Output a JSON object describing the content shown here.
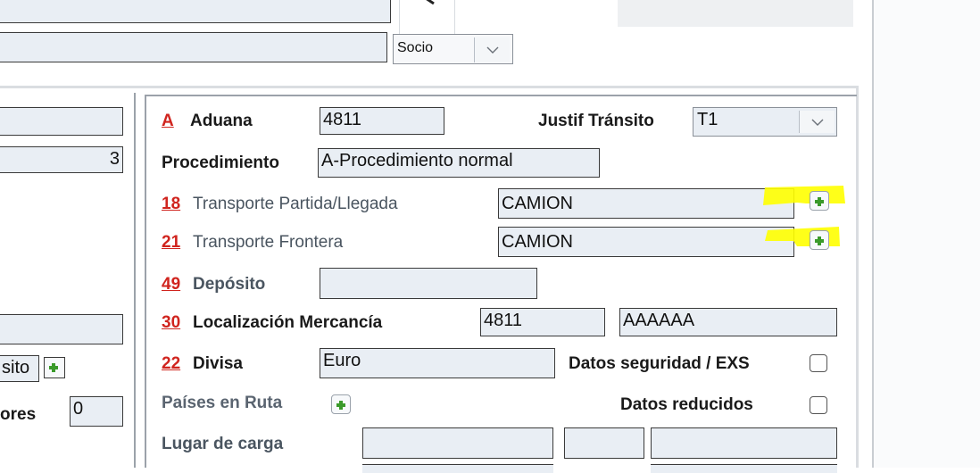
{
  "top": {
    "field1_value": "",
    "field2_value": "",
    "socio_select": "Socio"
  },
  "left_panel": {
    "field_a_value": "",
    "field_b_value": "3",
    "field_c_value": "",
    "transito_text": "sito",
    "errores_label": "ores",
    "errores_value": "0"
  },
  "form": {
    "aduana": {
      "code": "A",
      "label": "Aduana",
      "value": "4811"
    },
    "justif": {
      "label": "Justif Tránsito",
      "value": "T1"
    },
    "procedimiento": {
      "label": "Procedimiento",
      "value": "A-Procedimiento normal"
    },
    "transporte_partida": {
      "code": "18",
      "label": "Transporte Partida/Llegada",
      "value": "CAMION"
    },
    "transporte_frontera": {
      "code": "21",
      "label": "Transporte Frontera",
      "value": "CAMION"
    },
    "deposito": {
      "code": "49",
      "label": "Depósito",
      "value": ""
    },
    "localizacion": {
      "code": "30",
      "label": "Localización Mercancía",
      "value1": "4811",
      "value2": "AAAAAA"
    },
    "divisa": {
      "code": "22",
      "label": "Divisa",
      "value": "Euro"
    },
    "datos_seguridad": {
      "label": "Datos seguridad / EXS"
    },
    "paises_ruta": {
      "label": "Países en Ruta"
    },
    "datos_reducidos": {
      "label": "Datos reducidos"
    },
    "lugar_carga": {
      "label": "Lugar de carga",
      "value1": "",
      "value2": "",
      "value3": ""
    }
  },
  "colors": {
    "accent_red": "#d0241e",
    "field_bg": "#e9eef4",
    "highlight_yellow": "#ffff00",
    "plus_green": "#3a9a2a"
  },
  "icons": [
    "search-icon",
    "chevron-down-icon",
    "plus-icon"
  ]
}
